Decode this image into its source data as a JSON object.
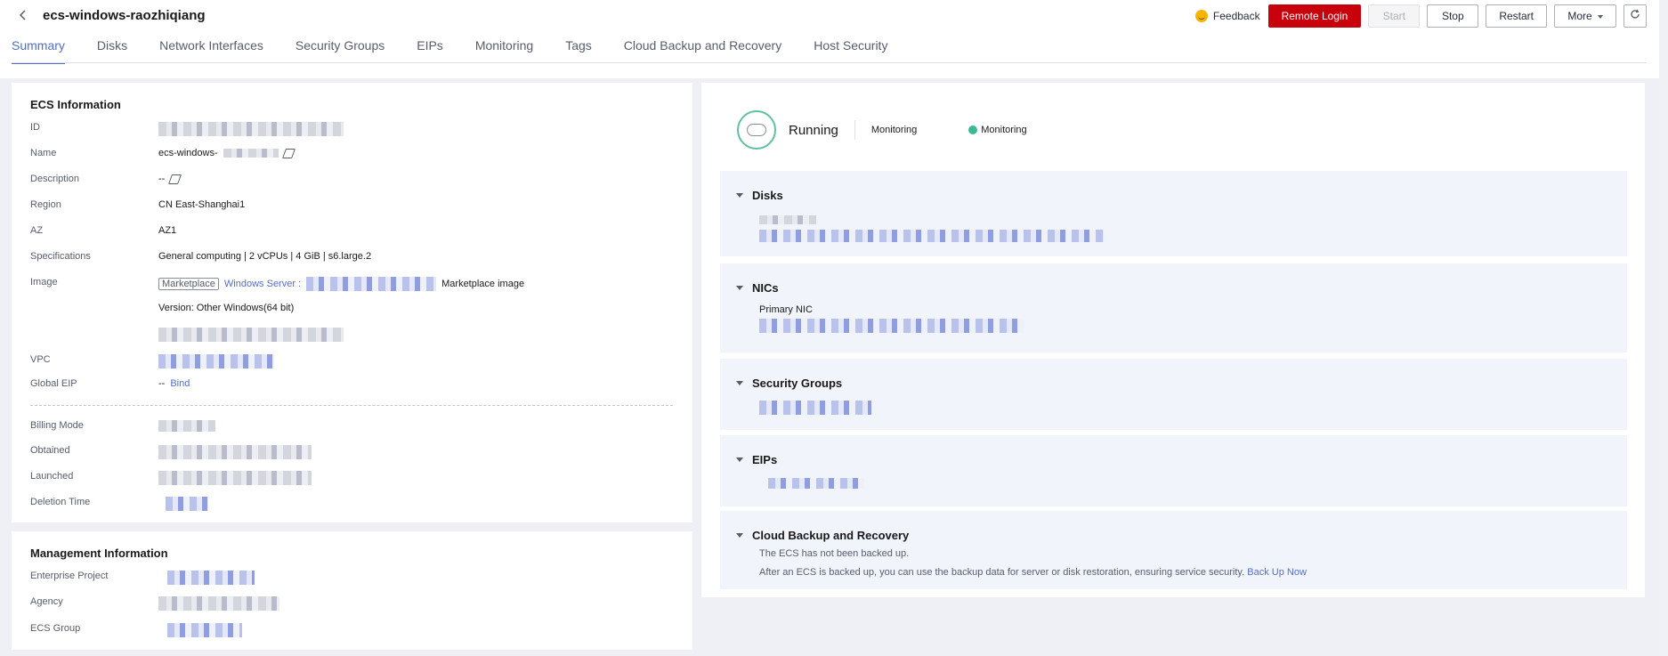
{
  "header": {
    "title": "ecs-windows-raozhiqiang",
    "feedback_label": "Feedback",
    "buttons": {
      "remote_login": "Remote Login",
      "start": "Start",
      "stop": "Stop",
      "restart": "Restart",
      "more": "More"
    }
  },
  "tabs": [
    "Summary",
    "Disks",
    "Network Interfaces",
    "Security Groups",
    "EIPs",
    "Monitoring",
    "Tags",
    "Cloud Backup and Recovery",
    "Host Security"
  ],
  "ecs_info": {
    "title": "ECS Information",
    "labels": {
      "id": "ID",
      "name": "Name",
      "description": "Description",
      "region": "Region",
      "az": "AZ",
      "specifications": "Specifications",
      "image": "Image",
      "vpc": "VPC",
      "global_eip": "Global EIP",
      "billing_mode": "Billing Mode",
      "obtained": "Obtained",
      "launched": "Launched",
      "deletion_time": "Deletion Time"
    },
    "values": {
      "name_prefix": "ecs-windows-",
      "description": "--",
      "region": "CN East-Shanghai1",
      "az": "AZ1",
      "specifications": "General computing | 2 vCPUs | 4 GiB | s6.large.2",
      "image_tag": "Marketplace",
      "image_link": "Windows Server :",
      "image_suffix": "Marketplace image",
      "version": "Version: Other Windows(64 bit)",
      "global_eip": "--",
      "bind_link": "Bind"
    }
  },
  "management": {
    "title": "Management Information",
    "labels": {
      "enterprise_project": "Enterprise Project",
      "agency": "Agency",
      "ecs_group": "ECS Group"
    }
  },
  "status": {
    "state": "Running",
    "monitoring_label": "Monitoring",
    "monitoring_status": "Monitoring"
  },
  "sections": {
    "disks": "Disks",
    "nics": "NICs",
    "primary_nic": "Primary NIC",
    "security_groups": "Security Groups",
    "eips": "EIPs",
    "cbr": "Cloud Backup and Recovery",
    "cbr_line1": "The ECS has not been backed up.",
    "cbr_line2": "After an ECS is backed up, you can use the backup data for server or disk restoration, ensuring service security.",
    "cbr_link": "Back Up Now"
  },
  "colors": {
    "accent": "#526ecc",
    "primary_button": "#c7000b",
    "running": "#3cba92"
  }
}
